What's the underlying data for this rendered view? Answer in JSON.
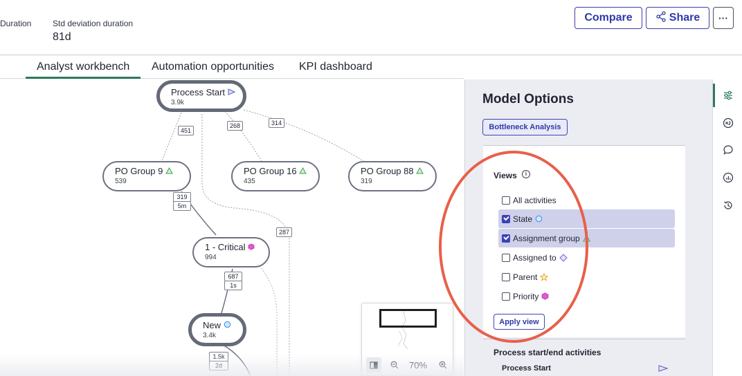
{
  "header": {
    "stats": [
      {
        "label": "Duration",
        "value": ""
      },
      {
        "label": "Std deviation duration",
        "value": "81d"
      }
    ],
    "compare_label": "Compare",
    "share_label": "Share",
    "more_label": "···"
  },
  "tabs": [
    {
      "label": "Analyst workbench",
      "active": true
    },
    {
      "label": "Automation opportunities",
      "active": false
    },
    {
      "label": "KPI dashboard",
      "active": false
    }
  ],
  "graph": {
    "nodes": [
      {
        "title": "Process Start",
        "count": "3.9k",
        "icon": "play-triangle-icon"
      },
      {
        "title": "PO Group 9",
        "count": "539",
        "icon": "green-triangle-icon"
      },
      {
        "title": "PO Group 16",
        "count": "435",
        "icon": "green-triangle-icon"
      },
      {
        "title": "PO Group 88",
        "count": "319",
        "icon": "green-triangle-icon"
      },
      {
        "title": "1 - Critical",
        "count": "994",
        "icon": "pink-hexagon-icon"
      },
      {
        "title": "New",
        "count": "3.4k",
        "icon": "blue-circle-icon"
      }
    ],
    "edge_labels": [
      "451",
      "268",
      "314",
      "319",
      "5m",
      "287",
      "687",
      "1s",
      "1.5k",
      "2d"
    ]
  },
  "minimap": {
    "zoom": "70%"
  },
  "panel": {
    "title": "Model Options",
    "bottleneck_label": "Bottleneck Analysis",
    "views_label": "Views",
    "info_glyph": "i",
    "options": [
      {
        "label": "All activities",
        "checked": false
      },
      {
        "label": "State",
        "checked": true,
        "icon": "blue-circle-icon"
      },
      {
        "label": "Assignment group",
        "checked": true,
        "icon": "green-triangle-icon"
      },
      {
        "label": "Assigned to",
        "checked": false,
        "icon": "purple-diamond-icon"
      },
      {
        "label": "Parent",
        "checked": false,
        "icon": "star-icon"
      },
      {
        "label": "Priority",
        "checked": false,
        "icon": "pink-hexagon-icon"
      }
    ],
    "apply_label": "Apply view",
    "section2_title": "Process start/end activities",
    "section2_item": "Process Start"
  },
  "colors": {
    "accent_green": "#2b7a5a",
    "brand_blue": "#2f3aa6",
    "highlight_red": "#e8604a",
    "selected_row": "#cfd0ea"
  }
}
